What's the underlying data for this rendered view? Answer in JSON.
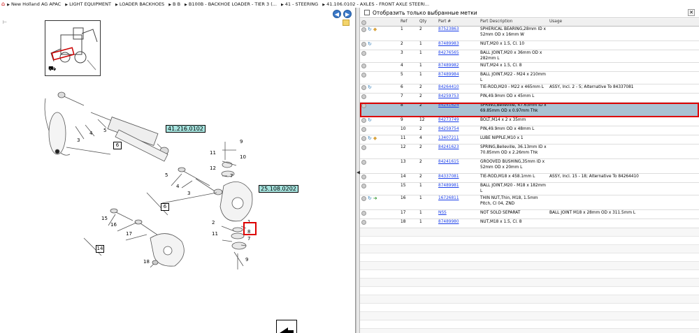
{
  "breadcrumb": {
    "items": [
      "New Holland AG APAC",
      "LIGHT EQUIPMENT",
      "LOADER BACKHOES",
      "B B",
      "B100B - BACKHOE LOADER - TIER 3 (...",
      "41 - STEERING",
      "41.106.0102 - AXLES - FRONT AXLE STEERI..."
    ]
  },
  "left": {
    "refs": {
      "r41": "41.216.0102",
      "r25": "25.108.0202"
    },
    "numbers": [
      "3",
      "4",
      "5",
      "6",
      "9",
      "11",
      "10",
      "12",
      "7",
      "5",
      "4",
      "3",
      "6",
      "1",
      "2",
      "11",
      "8",
      "7",
      "15",
      "16",
      "17",
      "14",
      "18",
      "9"
    ]
  },
  "right": {
    "filter_label": "Отобразить только выбранные метки",
    "columns": [
      "Ref",
      "Qty",
      "Part #",
      "Part Description",
      "Usage"
    ],
    "rows": [
      {
        "ref": "1",
        "qty": "2",
        "part": "87523863",
        "desc": "SPHERICAL BEARING,28mm ID x 52mm OD x 16mm W",
        "usage": "",
        "icons": "rb"
      },
      {
        "ref": "2",
        "qty": "1",
        "part": "87489983",
        "desc": "NUT,M20 x 1.5, Cl. 10",
        "usage": "",
        "icons": "r"
      },
      {
        "ref": "3",
        "qty": "1",
        "part": "84276565",
        "desc": "BALL JOINT,M20 x 36mm OD x 282mm L",
        "usage": "",
        "icons": ""
      },
      {
        "ref": "4",
        "qty": "1",
        "part": "87489982",
        "desc": "NUT,M24 x 1.5, Cl. 8",
        "usage": "",
        "icons": ""
      },
      {
        "ref": "5",
        "qty": "1",
        "part": "87489984",
        "desc": "BALL JOINT,M22 - M24 x 210mm L",
        "usage": "",
        "icons": ""
      },
      {
        "ref": "6",
        "qty": "2",
        "part": "84264410",
        "desc": "TIE-ROD,M20 - M22 x 465mm L",
        "usage": "ASSY, Incl. 2 - 5; Alternative To 84337081",
        "icons": "r"
      },
      {
        "ref": "7",
        "qty": "2",
        "part": "84259753",
        "desc": "PIN,49.9mm OD x 45mm L",
        "usage": "",
        "icons": ""
      },
      {
        "ref": "8",
        "qty": "2",
        "part": "84241624",
        "desc": "SPRING,Belleville, 47.63mm ID x 69.85mm OD x 0.97mm Thk",
        "usage": "",
        "icons": "",
        "selected": true
      },
      {
        "ref": "9",
        "qty": "12",
        "part": "84273749",
        "desc": "BOLT,M14 x 2 x 35mm",
        "usage": "",
        "icons": "r"
      },
      {
        "ref": "10",
        "qty": "2",
        "part": "84259754",
        "desc": "PIN,49.9mm OD x 48mm L",
        "usage": "",
        "icons": ""
      },
      {
        "ref": "11",
        "qty": "4",
        "part": "13407211",
        "desc": "LUBE NIPPLE,M10 x 1",
        "usage": "",
        "icons": "rb"
      },
      {
        "ref": "12",
        "qty": "2",
        "part": "84241623",
        "desc": "SPRING,Belleville, 36.13mm ID x 70.85mm OD x 2.26mm Thk",
        "usage": "",
        "icons": ""
      },
      {
        "ref": "13",
        "qty": "2",
        "part": "84241615",
        "desc": "GROOVED BUSHING,35mm ID x 52mm OD x 20mm L",
        "usage": "",
        "icons": ""
      },
      {
        "ref": "14",
        "qty": "2",
        "part": "84337081",
        "desc": "TIE-ROD,M18 x 458.1mm L",
        "usage": "ASSY, Incl. 15 - 18; Alternative To 84264410",
        "icons": ""
      },
      {
        "ref": "15",
        "qty": "1",
        "part": "87489981",
        "desc": "BALL JOINT,M20 - M18 x 182mm L",
        "usage": "",
        "icons": ""
      },
      {
        "ref": "16",
        "qty": "1",
        "part": "16726811",
        "desc": "THIN NUT,Thin, M18, 1.5mm Pitch, Cl 04, ZND",
        "usage": "",
        "icons": "rg"
      },
      {
        "ref": "17",
        "qty": "1",
        "part": "NSS",
        "desc": "NOT SOLD SEPARAT",
        "usage": "BALL JOINT M18 x 28mm OD x 311.5mm L",
        "icons": ""
      },
      {
        "ref": "18",
        "qty": "1",
        "part": "87489980",
        "desc": "NUT,M18 x 1.5, Cl. 8",
        "usage": "",
        "icons": ""
      }
    ]
  }
}
